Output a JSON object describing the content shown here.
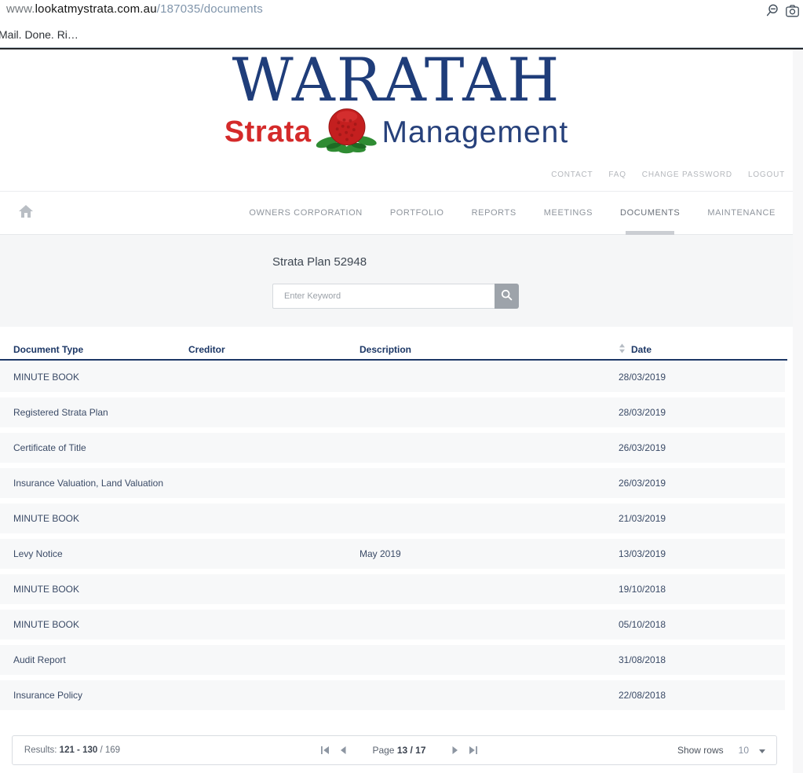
{
  "browser": {
    "url": {
      "www": "www.",
      "domain": "lookatmystrata.com.au",
      "path": "/187035/documents"
    },
    "overlay_text": "Mail. Done. Ri…"
  },
  "logo": {
    "title": "WARATAH",
    "strata": "Strata",
    "management": "Management"
  },
  "utility_nav": {
    "items": [
      {
        "label": "CONTACT"
      },
      {
        "label": "FAQ"
      },
      {
        "label": "CHANGE PASSWORD"
      },
      {
        "label": "LOGOUT"
      }
    ]
  },
  "main_nav": {
    "items": [
      {
        "label": "OWNERS CORPORATION",
        "active": false
      },
      {
        "label": "PORTFOLIO",
        "active": false
      },
      {
        "label": "REPORTS",
        "active": false
      },
      {
        "label": "MEETINGS",
        "active": false
      },
      {
        "label": "DOCUMENTS",
        "active": true
      },
      {
        "label": "MAINTENANCE",
        "active": false
      }
    ]
  },
  "hero": {
    "heading": "Strata Plan 52948",
    "search_placeholder": "Enter Keyword"
  },
  "table": {
    "columns": [
      {
        "label": "Document Type",
        "sortable": false
      },
      {
        "label": "Creditor",
        "sortable": false
      },
      {
        "label": "Description",
        "sortable": false
      },
      {
        "label": "Date",
        "sortable": true
      }
    ],
    "rows": [
      {
        "document_type": "MINUTE BOOK",
        "creditor": "",
        "description": "",
        "date": "28/03/2019"
      },
      {
        "document_type": "Registered Strata Plan",
        "creditor": "",
        "description": "",
        "date": "28/03/2019"
      },
      {
        "document_type": "Certificate of Title",
        "creditor": "",
        "description": "",
        "date": "26/03/2019"
      },
      {
        "document_type": "Insurance Valuation, Land Valuation",
        "creditor": "",
        "description": "",
        "date": "26/03/2019"
      },
      {
        "document_type": "MINUTE BOOK",
        "creditor": "",
        "description": "",
        "date": "21/03/2019"
      },
      {
        "document_type": "Levy Notice",
        "creditor": "",
        "description": "May 2019",
        "date": "13/03/2019"
      },
      {
        "document_type": "MINUTE BOOK",
        "creditor": "",
        "description": "",
        "date": "19/10/2018"
      },
      {
        "document_type": "MINUTE BOOK",
        "creditor": "",
        "description": "",
        "date": "05/10/2018"
      },
      {
        "document_type": "Audit Report",
        "creditor": "",
        "description": "",
        "date": "31/08/2018"
      },
      {
        "document_type": "Insurance Policy",
        "creditor": "",
        "description": "",
        "date": "22/08/2018"
      }
    ]
  },
  "footer": {
    "results_label": "Results:",
    "results_range": "121 - 130",
    "results_divider": "/",
    "results_total": "169",
    "page_label": "Page",
    "page_value": "13 / 17",
    "show_rows_label": "Show rows",
    "show_rows_value": "10"
  },
  "icons": {
    "zoom_out": "magnifier-with-minus",
    "camera": "screenshot-camera",
    "home": "house",
    "search": "magnifier",
    "sort": "up-down-triangles",
    "first_page": "bar-left-triangle",
    "prev_page": "left-triangle",
    "next_page": "right-triangle",
    "last_page": "right-triangle-bar",
    "dropdown_caret": "down-triangle",
    "waratah_flower": "red-waratah-bloom-with-leaves"
  },
  "colors": {
    "logo_navy": "#1f3d7a",
    "logo_red": "#d42a2a",
    "table_navy": "#1c3766",
    "row_bg": "#f7f8f9",
    "hero_bg": "#f5f6f7",
    "nav_gray": "#8f959d",
    "search_button_gray": "#9da3aa"
  }
}
